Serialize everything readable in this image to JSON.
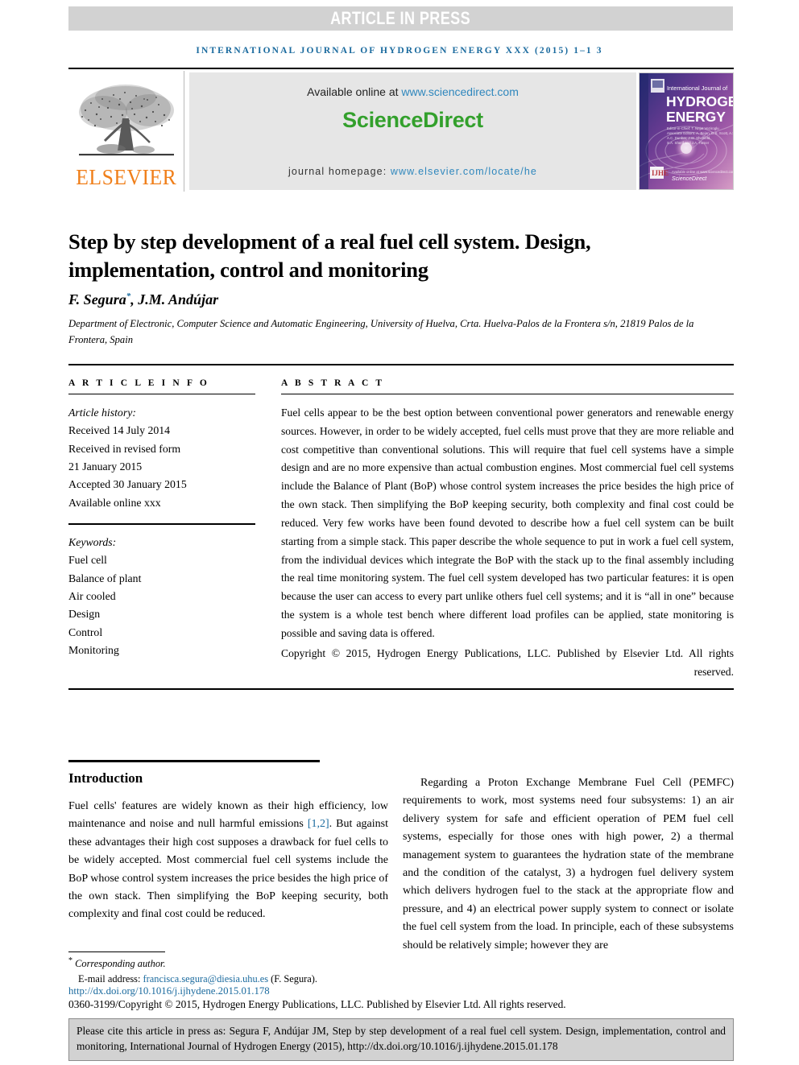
{
  "banner": {
    "label": "ARTICLE IN PRESS"
  },
  "running_head": {
    "text": "INTERNATIONAL JOURNAL OF HYDROGEN ENERGY XXX (2015) 1–1 3"
  },
  "masthead": {
    "publisher_name": "ELSEVIER",
    "available_prefix": "Available online at ",
    "available_url": "www.sciencedirect.com",
    "sciencedirect_logo": "ScienceDirect",
    "homepage_prefix": "journal homepage: ",
    "homepage_url": "www.elsevier.com/locate/he",
    "cover": {
      "line1": "International Journal of",
      "line2": "HYDROGEN",
      "line3": "ENERGY",
      "footer_brand": "ScienceDirect"
    }
  },
  "article": {
    "title": "Step by step development of a real fuel cell system. Design, implementation, control and monitoring",
    "authors": "F. Segura",
    "authors_rest": ", J.M. Andújar",
    "author_marker": "*",
    "affiliation": "Department of Electronic, Computer Science and Automatic Engineering, University of Huelva, Crta. Huelva-Palos de la Frontera s/n, 21819 Palos de la Frontera, Spain"
  },
  "info": {
    "heading": "A R T I C L E   I N F O",
    "history_label": "Article history:",
    "history": [
      "Received 14 July 2014",
      "Received in revised form",
      "21 January 2015",
      "Accepted 30 January 2015",
      "Available online xxx"
    ],
    "keywords_label": "Keywords:",
    "keywords": [
      "Fuel cell",
      "Balance of plant",
      "Air cooled",
      "Design",
      "Control",
      "Monitoring"
    ]
  },
  "abstract": {
    "heading": "A B S T R A C T",
    "body": "Fuel cells appear to be the best option between conventional power generators and renewable energy sources. However, in order to be widely accepted, fuel cells must prove that they are more reliable and cost competitive than conventional solutions. This will require that fuel cell systems have a simple design and are no more expensive than actual combustion engines. Most commercial fuel cell systems include the Balance of Plant (BoP) whose control system increases the price besides the high price of the own stack. Then simplifying the BoP keeping security, both complexity and final cost could be reduced. Very few works have been found devoted to describe how a fuel cell system can be built starting from a simple stack. This paper describe the whole sequence to put in work a fuel cell system, from the individual devices which integrate the BoP with the stack up to the final assembly including the real time monitoring system. The fuel cell system developed has two particular features: it is open because the user can access to every part unlike others fuel cell systems; and it is “all in one” because the system is a whole test bench where different load profiles can be applied, state monitoring is possible and saving data is offered.",
    "copyright": "Copyright © 2015, Hydrogen Energy Publications, LLC. Published by Elsevier Ltd. All rights reserved."
  },
  "main": {
    "intro_heading": "Introduction",
    "left_para_1a": "Fuel cells' features are widely known as their high efficiency, low maintenance and noise and null harmful emissions ",
    "left_ref": "[1,2]",
    "left_para_1b": ". But against these advantages their high cost supposes a drawback for fuel cells to be widely accepted. Most commercial fuel cell systems include the BoP whose control system increases the price besides the high price of the own stack. Then simplifying the BoP keeping security, both complexity and final cost could be reduced.",
    "right_para_1": "Regarding a Proton Exchange Membrane Fuel Cell (PEMFC) requirements to work, most systems need four subsystems: 1) an air delivery system for safe and efficient operation of PEM fuel cell systems, especially for those ones with high power, 2) a thermal management system to guarantees the hydration state of the membrane and the condition of the catalyst, 3) a hydrogen fuel delivery system which delivers hydrogen fuel to the stack at the appropriate flow and pressure, and 4) an electrical power supply system to connect or isolate the fuel cell system from the load. In principle, each of these subsystems should be relatively simple; however they are"
  },
  "footer": {
    "corresponding": "Corresponding author.",
    "corresponding_marker": "*",
    "email_label": "E-mail address: ",
    "email": "francisca.segura@diesia.uhu.es",
    "email_suffix": " (F. Segura).",
    "doi": "http://dx.doi.org/10.1016/j.ijhydene.2015.01.178",
    "issn_copyright": "0360-3199/Copyright © 2015, Hydrogen Energy Publications, LLC. Published by Elsevier Ltd. All rights reserved."
  },
  "citation_box": {
    "text": "Please cite this article in press as: Segura F, Andújar JM, Step by step development of a real fuel cell system. Design, implementation, control and monitoring, International Journal of Hydrogen Energy (2015), http://dx.doi.org/10.1016/j.ijhydene.2015.01.178"
  },
  "colors": {
    "banner_bg": "#d2d2d2",
    "accent_blue": "#1a6a9e",
    "link_blue": "#2f87bd",
    "sciencedirect_green": "#33a02c",
    "elsevier_orange": "#f07f1a",
    "panel_gray": "#e6e6e6"
  }
}
